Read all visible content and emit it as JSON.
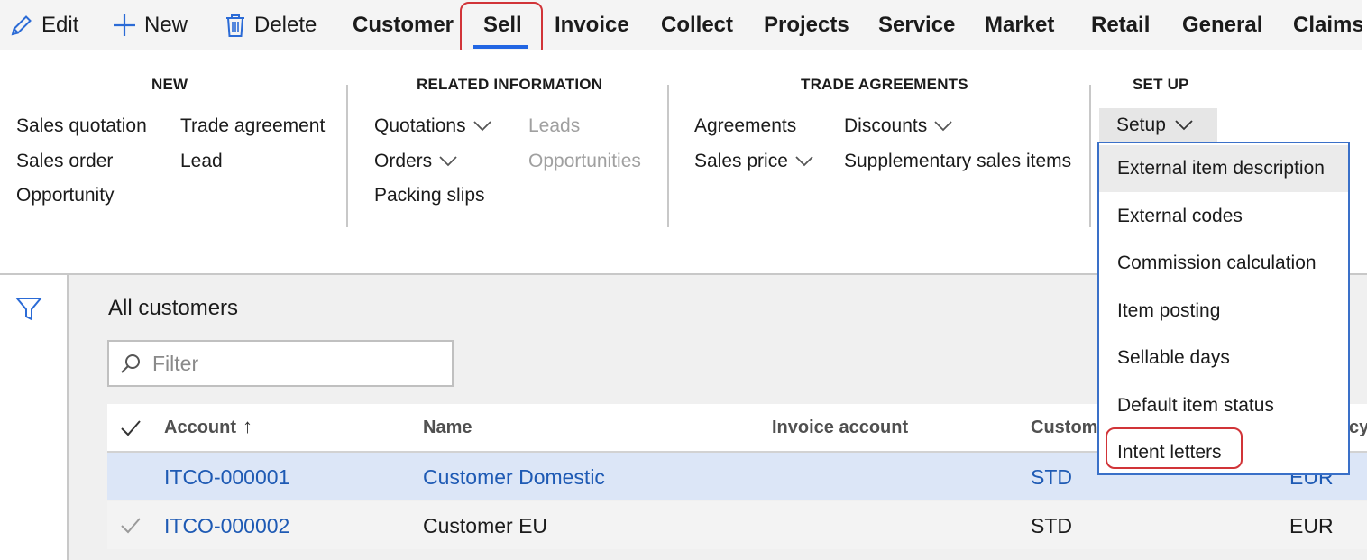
{
  "commands": {
    "edit": "Edit",
    "new": "New",
    "delete": "Delete"
  },
  "tabs": [
    "Customer",
    "Sell",
    "Invoice",
    "Collect",
    "Projects",
    "Service",
    "Market",
    "Retail",
    "General",
    "ClaimsM"
  ],
  "active_tab": "Sell",
  "ribbon": {
    "new_group": {
      "title": "NEW",
      "items": [
        "Sales quotation",
        "Trade agreement",
        "Sales order",
        "Lead",
        "Opportunity"
      ]
    },
    "related_group": {
      "title": "RELATED INFORMATION",
      "quotations": "Quotations",
      "orders": "Orders",
      "packing_slips": "Packing slips",
      "leads": "Leads",
      "opportunities": "Opportunities"
    },
    "trade_group": {
      "title": "TRADE AGREEMENTS",
      "agreements": "Agreements",
      "sales_price": "Sales price",
      "discounts": "Discounts",
      "supplementary": "Supplementary sales items"
    },
    "setup_group": {
      "title": "SET UP",
      "setup_button": "Setup"
    }
  },
  "setup_menu": {
    "items": [
      "External item description",
      "External codes",
      "Commission calculation",
      "Item posting",
      "Sellable days",
      "Default item status",
      "Intent letters"
    ],
    "hovered_item": "External item description",
    "highlighted_item": "Intent letters"
  },
  "list": {
    "title": "All customers",
    "filter_placeholder": "Filter",
    "columns": {
      "account": "Account",
      "name": "Name",
      "invoice_account": "Invoice account",
      "customer_group": "Custome",
      "currency": "cy"
    },
    "sort_indicator": "↑",
    "rows": [
      {
        "account": "ITCO-000001",
        "name": "Customer Domestic",
        "invoice_account": "",
        "customer_group": "STD",
        "currency": "EUR",
        "selected": true
      },
      {
        "account": "ITCO-000002",
        "name": "Customer EU",
        "invoice_account": "",
        "customer_group": "STD",
        "currency": "EUR",
        "selected": false
      }
    ]
  },
  "colors": {
    "accent": "#2266e3",
    "link": "#1e5ab4",
    "annotation": "#d13438",
    "selected_row": "#dce6f7"
  },
  "icons": [
    "pencil-icon",
    "plus-icon",
    "trash-icon",
    "chevron-down-icon",
    "filter-funnel-icon",
    "search-icon",
    "checkmark-icon"
  ]
}
